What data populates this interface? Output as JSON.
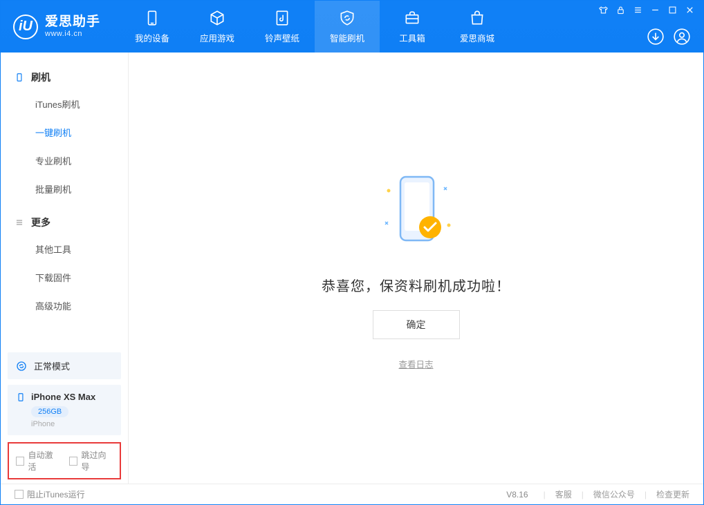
{
  "app": {
    "name": "爱思助手",
    "url": "www.i4.cn"
  },
  "tabs": {
    "device": "我的设备",
    "apps": "应用游戏",
    "ringtones": "铃声壁纸",
    "flash": "智能刷机",
    "toolbox": "工具箱",
    "store": "爱思商城"
  },
  "sidebar": {
    "group1": "刷机",
    "items1": {
      "itunes": "iTunes刷机",
      "onekey": "一键刷机",
      "pro": "专业刷机",
      "batch": "批量刷机"
    },
    "group2": "更多",
    "items2": {
      "other": "其他工具",
      "firmware": "下载固件",
      "advanced": "高级功能"
    }
  },
  "mode": {
    "label": "正常模式"
  },
  "device": {
    "name": "iPhone XS Max",
    "storage": "256GB",
    "type": "iPhone"
  },
  "options": {
    "auto_activate": "自动激活",
    "skip_guide": "跳过向导"
  },
  "main": {
    "success": "恭喜您，保资料刷机成功啦！",
    "ok": "确定",
    "log": "查看日志"
  },
  "footer": {
    "block_itunes": "阻止iTunes运行",
    "version": "V8.16",
    "support": "客服",
    "wechat": "微信公众号",
    "update": "检查更新"
  }
}
